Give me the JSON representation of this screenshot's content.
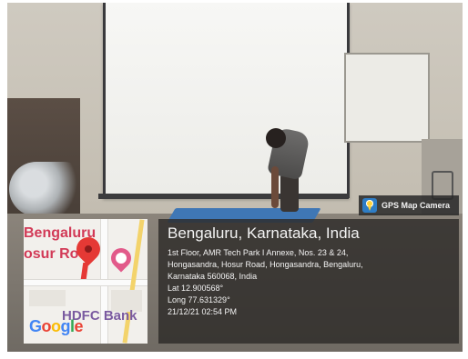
{
  "gps_badge": {
    "label": "GPS Map Camera",
    "icon": "gps-map-camera-icon"
  },
  "map": {
    "city_label": "Bengaluru",
    "area_label": "osur Ro",
    "bank_label": "HDFC Bank",
    "logo_letters": [
      "G",
      "o",
      "o",
      "g",
      "l",
      "e"
    ],
    "pin_icon": "map-pin-icon",
    "bank_marker_icon": "bank-marker-icon"
  },
  "location": {
    "title": "Bengaluru, Karnataka, India",
    "address_lines": [
      "1st Floor, AMR Tech Park I Annexe, Nos. 23 & 24,",
      "Hongasandra, Hosur Road, Hongasandra, Bengaluru,",
      "Karnataka 560068, India"
    ],
    "lat": "Lat 12.900568°",
    "long": "Long 77.631329°",
    "datetime": "21/12/21 02:54 PM"
  },
  "colors": {
    "map_red": "#d23a57",
    "overlay_bg": "#2d2b28",
    "mat_blue": "#3f77b5"
  }
}
